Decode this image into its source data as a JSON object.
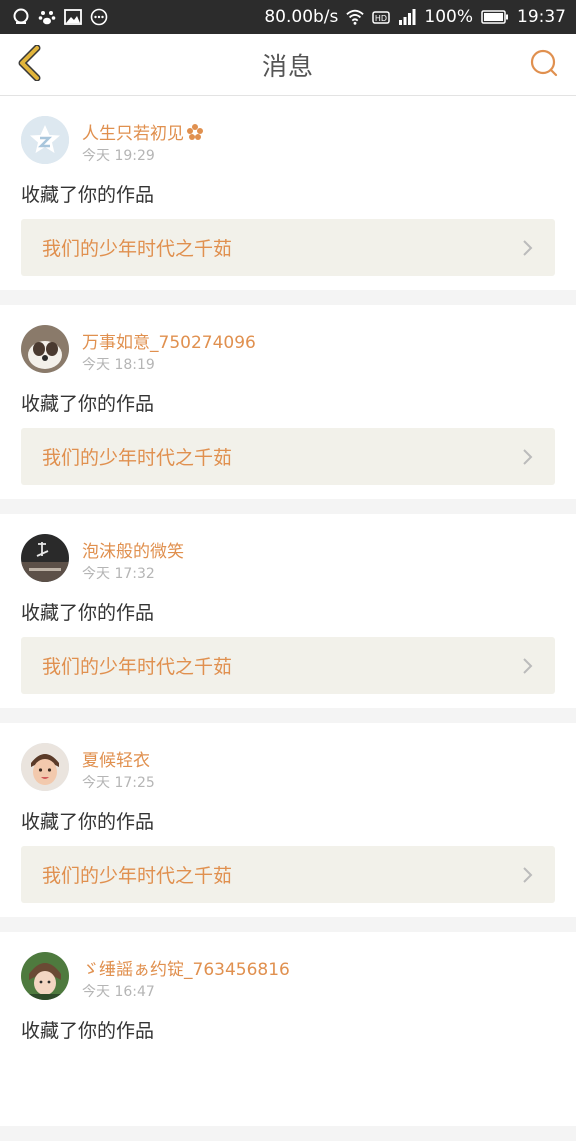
{
  "status_bar": {
    "speed": "80.00b/s",
    "battery": "100%",
    "time": "19:37",
    "icons": [
      "qq-icon",
      "paw-icon",
      "image-icon",
      "more-icon",
      "wifi-icon",
      "hd-icon",
      "signal-icon",
      "battery-icon"
    ]
  },
  "header": {
    "title": "消息",
    "back_icon": "chevron-left-icon",
    "search_icon": "search-icon"
  },
  "colors": {
    "accent": "#e0904f",
    "back_icon": "#e2b53b",
    "card_link_bg": "#f2f1ea",
    "status_bar": "#2c2c2c"
  },
  "messages": [
    {
      "username": "人生只若初见",
      "time": "今天 19:29",
      "action": "收藏了你的作品",
      "work": "我们的少年时代之千茹"
    },
    {
      "username": "万事如意_750274096",
      "time": "今天 18:19",
      "action": "收藏了你的作品",
      "work": "我们的少年时代之千茹"
    },
    {
      "username": "泡沫般的微笑",
      "time": "今天 17:32",
      "action": "收藏了你的作品",
      "work": "我们的少年时代之千茹"
    },
    {
      "username": "夏候轻衣",
      "time": "今天 17:25",
      "action": "收藏了你的作品",
      "work": "我们的少年时代之千茹"
    },
    {
      "username": "ゞ缍謡ぁ约锭_763456816",
      "time": "今天 16:47",
      "action": "收藏了你的作品",
      "work": ""
    }
  ]
}
